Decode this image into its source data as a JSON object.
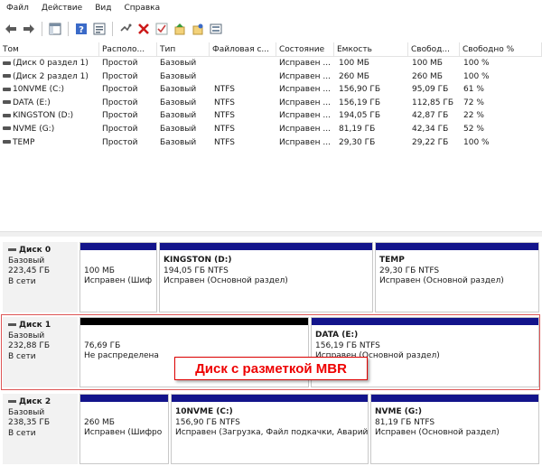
{
  "menu": [
    "Файл",
    "Действие",
    "Вид",
    "Справка"
  ],
  "toolbar": [
    "back-icon",
    "forward-icon",
    "console-tree-icon",
    "help-icon",
    "properties-icon",
    "connect-icon",
    "delete-icon",
    "check-icon",
    "up-icon",
    "wizard-icon",
    "view-icon"
  ],
  "columns": [
    "Том",
    "Располо...",
    "Тип",
    "Файловая с...",
    "Состояние",
    "Емкость",
    "Свобод...",
    "Свободно %"
  ],
  "volumes": [
    [
      "(Диск 0 раздел 1)",
      "Простой",
      "Базовый",
      "",
      "Исправен ...",
      "100 МБ",
      "100 МБ",
      "100 %"
    ],
    [
      "(Диск 2 раздел 1)",
      "Простой",
      "Базовый",
      "",
      "Исправен ...",
      "260 МБ",
      "260 МБ",
      "100 %"
    ],
    [
      "10NVME (C:)",
      "Простой",
      "Базовый",
      "NTFS",
      "Исправен ...",
      "156,90 ГБ",
      "95,09 ГБ",
      "61 %"
    ],
    [
      "DATA (E:)",
      "Простой",
      "Базовый",
      "NTFS",
      "Исправен ...",
      "156,19 ГБ",
      "112,85 ГБ",
      "72 %"
    ],
    [
      "KINGSTON (D:)",
      "Простой",
      "Базовый",
      "NTFS",
      "Исправен ...",
      "194,05 ГБ",
      "42,87 ГБ",
      "22 %"
    ],
    [
      "NVME (G:)",
      "Простой",
      "Базовый",
      "NTFS",
      "Исправен ...",
      "81,19 ГБ",
      "42,34 ГБ",
      "52 %"
    ],
    [
      "TEMP",
      "Простой",
      "Базовый",
      "NTFS",
      "Исправен ...",
      "29,30 ГБ",
      "29,22 ГБ",
      "100 %"
    ]
  ],
  "disks": [
    {
      "name": "Диск 0",
      "type": "Базовый",
      "size": "223,45 ГБ",
      "status": "В сети",
      "partitions": [
        {
          "title": "",
          "size": "100 МБ",
          "status": "Исправен (Шиф"
        },
        {
          "title": "KINGSTON  (D:)",
          "size": "194,05 ГБ NTFS",
          "status": "Исправен (Основной раздел)"
        },
        {
          "title": "TEMP",
          "size": "29,30 ГБ NTFS",
          "status": "Исправен (Основной раздел)"
        }
      ]
    },
    {
      "name": "Диск 1",
      "type": "Базовый",
      "size": "232,88 ГБ",
      "status": "В сети",
      "partitions": [
        {
          "title": "",
          "size": "76,69 ГБ",
          "status": "Не распределена"
        },
        {
          "title": "DATA  (E:)",
          "size": "156,19 ГБ NTFS",
          "status": "Исправен (Основной раздел)"
        }
      ]
    },
    {
      "name": "Диск 2",
      "type": "Базовый",
      "size": "238,35 ГБ",
      "status": "В сети",
      "partitions": [
        {
          "title": "",
          "size": "260 МБ",
          "status": "Исправен (Шифро"
        },
        {
          "title": "10NVME  (C:)",
          "size": "156,90 ГБ NTFS",
          "status": "Исправен (Загрузка, Файл подкачки, Аварий"
        },
        {
          "title": "NVME  (G:)",
          "size": "81,19 ГБ NTFS",
          "status": "Исправен (Основной раздел)"
        }
      ]
    }
  ],
  "callout": "Диск с разметкой MBR",
  "colors": {
    "primary_bar": "#13148b",
    "unallocated_bar": "#000000",
    "callout": "#e00000"
  }
}
